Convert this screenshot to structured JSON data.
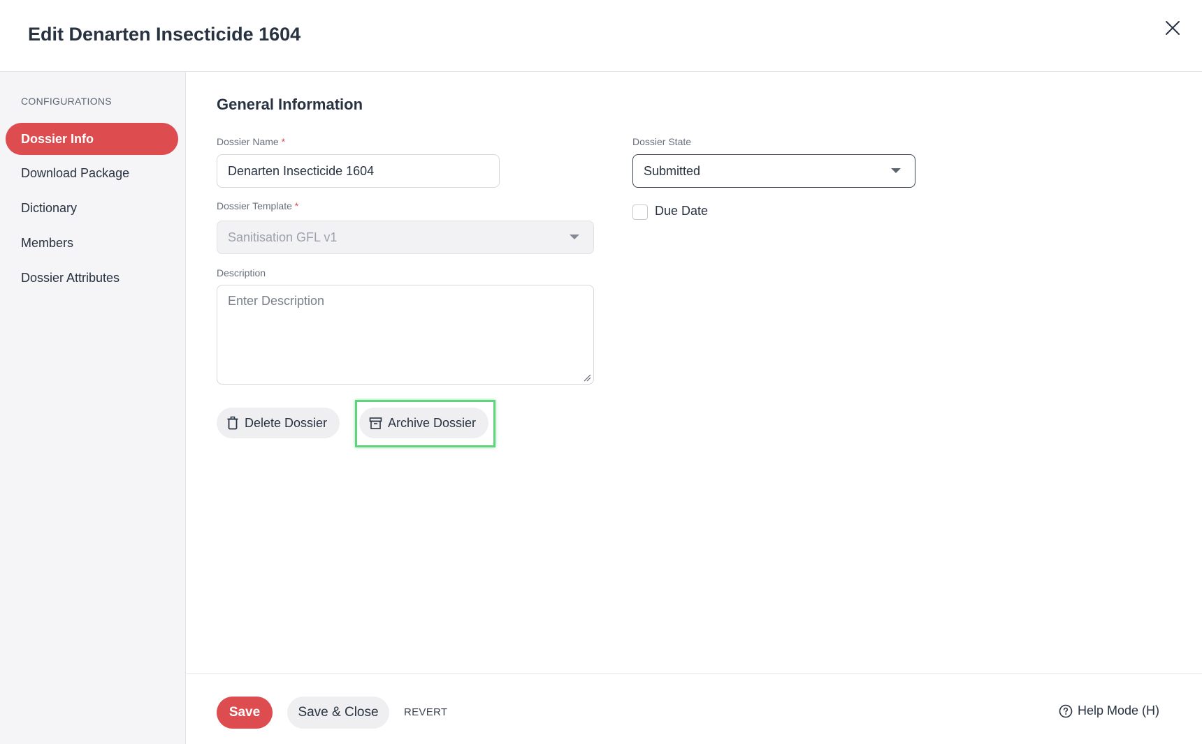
{
  "header": {
    "title": "Edit Denarten Insecticide 1604",
    "close_icon": "close-icon"
  },
  "sidebar": {
    "section_label": "CONFIGURATIONS",
    "items": [
      {
        "label": "Dossier Info",
        "active": true
      },
      {
        "label": "Download Package",
        "active": false
      },
      {
        "label": "Dictionary",
        "active": false
      },
      {
        "label": "Members",
        "active": false
      },
      {
        "label": "Dossier Attributes",
        "active": false
      }
    ]
  },
  "main": {
    "section_title": "General Information",
    "dossier_name": {
      "label": "Dossier Name",
      "required_mark": "*",
      "value": "Denarten Insecticide 1604"
    },
    "dossier_template": {
      "label": "Dossier Template",
      "required_mark": "*",
      "value": "Sanitisation GFL v1",
      "disabled": true
    },
    "description": {
      "label": "Description",
      "placeholder": "Enter Description",
      "value": ""
    },
    "dossier_state": {
      "label": "Dossier State",
      "value": "Submitted"
    },
    "due_date": {
      "label": "Due Date",
      "checked": false
    },
    "delete_button": {
      "label": "Delete Dossier",
      "icon": "trash-icon"
    },
    "archive_button": {
      "label": "Archive Dossier",
      "icon": "archive-icon",
      "highlighted": true
    }
  },
  "footer": {
    "save_label": "Save",
    "save_close_label": "Save & Close",
    "revert_label": "REVERT",
    "help_label": "Help Mode (H)",
    "help_icon": "help-circle-icon"
  },
  "colors": {
    "accent": "#dd4d50",
    "highlight": "#5fd47c",
    "sidebar_bg": "#f5f5f7"
  }
}
